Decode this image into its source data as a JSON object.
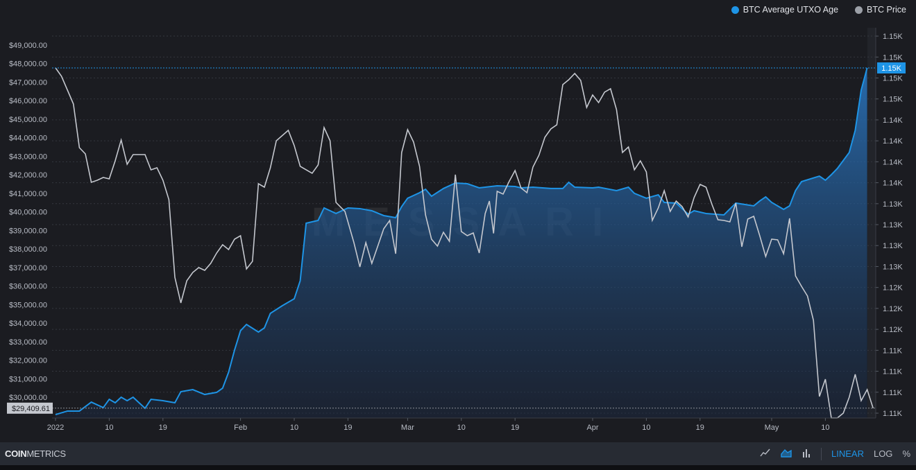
{
  "legend": [
    {
      "label": "BTC Average UTXO Age",
      "color": "#1e94e6"
    },
    {
      "label": "BTC Price",
      "color": "#9ca0a8"
    }
  ],
  "footer": {
    "brand_bold": "COIN",
    "brand_light": "METRICS",
    "icons": [
      "line-chart-icon",
      "area-chart-icon",
      "bar-chart-icon"
    ],
    "linear": "LINEAR",
    "log": "LOG",
    "percent": "%"
  },
  "watermark": "MESSARI",
  "chart_data": {
    "type": "line",
    "title": "",
    "x_start_date": "2022-01-01",
    "x_unit": "days since 2022-01-01",
    "x_tick_labels": [
      {
        "day": 0,
        "label": "2022"
      },
      {
        "day": 9,
        "label": "10"
      },
      {
        "day": 18,
        "label": "19"
      },
      {
        "day": 31,
        "label": "Feb"
      },
      {
        "day": 40,
        "label": "10"
      },
      {
        "day": 49,
        "label": "19"
      },
      {
        "day": 59,
        "label": "Mar"
      },
      {
        "day": 68,
        "label": "10"
      },
      {
        "day": 77,
        "label": "19"
      },
      {
        "day": 90,
        "label": "Apr"
      },
      {
        "day": 99,
        "label": "10"
      },
      {
        "day": 108,
        "label": "19"
      },
      {
        "day": 120,
        "label": "May"
      },
      {
        "day": 129,
        "label": "10"
      }
    ],
    "left_axis": {
      "label": "BTC Price",
      "ylim": [
        29000,
        49500
      ],
      "ticks": [
        "$49,000.00",
        "$48,000.00",
        "$47,000.00",
        "$46,000.00",
        "$45,000.00",
        "$44,000.00",
        "$43,000.00",
        "$42,000.00",
        "$41,000.00",
        "$40,000.00",
        "$39,000.00",
        "$38,000.00",
        "$37,000.00",
        "$36,000.00",
        "$35,000.00",
        "$34,000.00",
        "$33,000.00",
        "$32,000.00",
        "$31,000.00",
        "$30,000.00"
      ],
      "tick_values": [
        49000,
        48000,
        47000,
        46000,
        45000,
        44000,
        43000,
        42000,
        41000,
        40000,
        39000,
        38000,
        37000,
        36000,
        35000,
        34000,
        33000,
        32000,
        31000,
        30000
      ],
      "current_label": "$29,409.61",
      "current_value": 29409.61
    },
    "right_axis": {
      "label": "BTC Average UTXO Age",
      "ticks": [
        "1.15K",
        "1.15K",
        "1.15K",
        "1.15K",
        "1.14K",
        "1.14K",
        "1.14K",
        "1.14K",
        "1.13K",
        "1.13K",
        "1.13K",
        "1.13K",
        "1.12K",
        "1.12K",
        "1.12K",
        "1.11K",
        "1.11K",
        "1.11K",
        "1.11K"
      ],
      "tick_values": [
        1152.5,
        1150,
        1147.5,
        1145,
        1142.5,
        1140,
        1137.5,
        1135,
        1132.5,
        1130,
        1127.5,
        1125,
        1122.5,
        1120,
        1117.5,
        1115,
        1112.5,
        1110,
        1107.5
      ],
      "current_label": "1.15K",
      "current_value": 1148.7
    },
    "series": [
      {
        "name": "BTC Price",
        "axis": "left",
        "color": "#c5c8cf",
        "points": [
          [
            0,
            47770
          ],
          [
            1,
            47317
          ],
          [
            2,
            46569
          ],
          [
            3,
            45821
          ],
          [
            4,
            43465
          ],
          [
            5,
            43128
          ],
          [
            6,
            41595
          ],
          [
            7,
            41707
          ],
          [
            8,
            41857
          ],
          [
            9,
            41782
          ],
          [
            10,
            42754
          ],
          [
            11,
            43878
          ],
          [
            12,
            42569
          ],
          [
            13,
            43091
          ],
          [
            14,
            43091
          ],
          [
            15,
            43091
          ],
          [
            16,
            42268
          ],
          [
            17,
            42380
          ],
          [
            18,
            41707
          ],
          [
            19,
            40660
          ],
          [
            20,
            36471
          ],
          [
            21,
            35087
          ],
          [
            22,
            36284
          ],
          [
            23,
            36733
          ],
          [
            24,
            36995
          ],
          [
            25,
            36845
          ],
          [
            26,
            37219
          ],
          [
            27,
            37780
          ],
          [
            28,
            38229
          ],
          [
            29,
            37967
          ],
          [
            30,
            38528
          ],
          [
            31,
            38715
          ],
          [
            32,
            36920
          ],
          [
            33,
            37331
          ],
          [
            34,
            41520
          ],
          [
            35,
            41333
          ],
          [
            36,
            42380
          ],
          [
            37,
            43839
          ],
          [
            39,
            44400
          ],
          [
            40,
            43577
          ],
          [
            41,
            42455
          ],
          [
            43,
            42081
          ],
          [
            44,
            42530
          ],
          [
            45,
            44549
          ],
          [
            46,
            43839
          ],
          [
            47,
            40510
          ],
          [
            48.5,
            40024
          ],
          [
            50,
            38341
          ],
          [
            51,
            37032
          ],
          [
            52,
            38341
          ],
          [
            53,
            37219
          ],
          [
            54,
            38154
          ],
          [
            55,
            39089
          ],
          [
            56,
            39538
          ],
          [
            57,
            37742
          ],
          [
            58,
            43203
          ],
          [
            59,
            44437
          ],
          [
            60,
            43764
          ],
          [
            61,
            42455
          ],
          [
            62,
            39837
          ],
          [
            63,
            38528
          ],
          [
            64,
            38154
          ],
          [
            65,
            38902
          ],
          [
            66,
            38416
          ],
          [
            67,
            42006
          ],
          [
            68,
            38939
          ],
          [
            69,
            38715
          ],
          [
            70,
            38865
          ],
          [
            71,
            37780
          ],
          [
            72,
            39912
          ],
          [
            72.7,
            40585
          ],
          [
            73.4,
            38840
          ],
          [
            74,
            41109
          ],
          [
            75,
            40959
          ],
          [
            76,
            41632
          ],
          [
            77,
            42231
          ],
          [
            78,
            41296
          ],
          [
            79,
            41034
          ],
          [
            80,
            42418
          ],
          [
            81,
            43054
          ],
          [
            82,
            44026
          ],
          [
            83,
            44475
          ],
          [
            84,
            44699
          ],
          [
            85,
            46868
          ],
          [
            86,
            47130
          ],
          [
            87,
            47467
          ],
          [
            88,
            47093
          ],
          [
            89,
            45634
          ],
          [
            90,
            46307
          ],
          [
            91,
            45896
          ],
          [
            92,
            46457
          ],
          [
            93,
            46644
          ],
          [
            94,
            45522
          ],
          [
            95,
            43203
          ],
          [
            96,
            43502
          ],
          [
            97,
            42268
          ],
          [
            98,
            42754
          ],
          [
            99,
            42156
          ],
          [
            100,
            39538
          ],
          [
            101,
            40211
          ],
          [
            102,
            41146
          ],
          [
            103,
            40024
          ],
          [
            104,
            40585
          ],
          [
            105,
            40286
          ],
          [
            106,
            39725
          ],
          [
            107,
            40772
          ],
          [
            108,
            41483
          ],
          [
            109,
            41333
          ],
          [
            110,
            40398
          ],
          [
            111,
            39575
          ],
          [
            112,
            39538
          ],
          [
            113,
            39463
          ],
          [
            114,
            40473
          ],
          [
            115,
            38117
          ],
          [
            116,
            39613
          ],
          [
            117,
            39762
          ],
          [
            118,
            38715
          ],
          [
            119,
            37593
          ],
          [
            120,
            38528
          ],
          [
            121,
            38491
          ],
          [
            122,
            37742
          ],
          [
            123,
            39650
          ],
          [
            124,
            36546
          ],
          [
            125,
            35985
          ],
          [
            126,
            35461
          ],
          [
            127,
            34152
          ],
          [
            128,
            30039
          ],
          [
            129,
            30974
          ],
          [
            130,
            28880
          ],
          [
            131,
            28880
          ],
          [
            132,
            29141
          ],
          [
            133,
            30002
          ],
          [
            134,
            31236
          ],
          [
            135,
            29815
          ],
          [
            136,
            30413
          ],
          [
            137,
            29409.61
          ]
        ]
      },
      {
        "name": "BTC Average UTXO Age",
        "axis": "right",
        "color": "#1e94e6",
        "points": [
          [
            0,
            1107.33
          ],
          [
            2,
            1107.75
          ],
          [
            4,
            1107.75
          ],
          [
            6,
            1108.82
          ],
          [
            8,
            1108.16
          ],
          [
            9,
            1109.15
          ],
          [
            10,
            1108.74
          ],
          [
            11,
            1109.4
          ],
          [
            12,
            1108.99
          ],
          [
            13,
            1109.4
          ],
          [
            15,
            1108.08
          ],
          [
            16,
            1109.15
          ],
          [
            18,
            1108.99
          ],
          [
            20,
            1108.74
          ],
          [
            21,
            1110.06
          ],
          [
            23,
            1110.31
          ],
          [
            25,
            1109.73
          ],
          [
            27,
            1109.98
          ],
          [
            28,
            1110.48
          ],
          [
            29,
            1112.38
          ],
          [
            30,
            1115.03
          ],
          [
            31,
            1117.34
          ],
          [
            32,
            1118.09
          ],
          [
            34,
            1117.18
          ],
          [
            35,
            1117.68
          ],
          [
            36,
            1119.41
          ],
          [
            38,
            1120.32
          ],
          [
            40,
            1121.15
          ],
          [
            41,
            1123.3
          ],
          [
            42,
            1130.17
          ],
          [
            44,
            1130.5
          ],
          [
            45,
            1131.99
          ],
          [
            47,
            1131.33
          ],
          [
            49,
            1131.99
          ],
          [
            51,
            1131.91
          ],
          [
            53,
            1131.66
          ],
          [
            55,
            1131.08
          ],
          [
            57,
            1130.83
          ],
          [
            58,
            1132.15
          ],
          [
            59,
            1133.15
          ],
          [
            61,
            1133.81
          ],
          [
            62,
            1134.22
          ],
          [
            63,
            1133.39
          ],
          [
            65,
            1134.31
          ],
          [
            67,
            1134.97
          ],
          [
            69,
            1134.88
          ],
          [
            71,
            1134.39
          ],
          [
            74,
            1134.64
          ],
          [
            77,
            1134.55
          ],
          [
            78,
            1134.39
          ],
          [
            80,
            1134.47
          ],
          [
            83,
            1134.31
          ],
          [
            85,
            1134.31
          ],
          [
            86,
            1135.05
          ],
          [
            87,
            1134.47
          ],
          [
            90,
            1134.39
          ],
          [
            91,
            1134.47
          ],
          [
            94,
            1134.06
          ],
          [
            96,
            1134.47
          ],
          [
            97,
            1133.73
          ],
          [
            99,
            1133.15
          ],
          [
            101,
            1133.56
          ],
          [
            102,
            1132.65
          ],
          [
            104,
            1132.57
          ],
          [
            106,
            1131.24
          ],
          [
            107,
            1131.66
          ],
          [
            109,
            1131.33
          ],
          [
            112,
            1131.16
          ],
          [
            114,
            1132.57
          ],
          [
            117,
            1132.24
          ],
          [
            118,
            1132.82
          ],
          [
            119,
            1133.31
          ],
          [
            120,
            1132.65
          ],
          [
            122,
            1131.82
          ],
          [
            123,
            1132.24
          ],
          [
            124,
            1134.06
          ],
          [
            125,
            1135.13
          ],
          [
            128,
            1135.79
          ],
          [
            129,
            1135.3
          ],
          [
            130,
            1135.96
          ],
          [
            131,
            1136.7
          ],
          [
            133,
            1138.61
          ],
          [
            134,
            1141.25
          ],
          [
            135,
            1146.05
          ],
          [
            136,
            1148.7
          ]
        ]
      }
    ],
    "grid": true,
    "legend_position": "top-right"
  }
}
